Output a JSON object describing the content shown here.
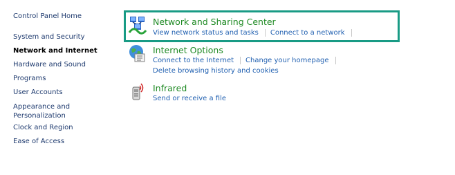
{
  "sidebar": {
    "items": [
      {
        "label": "Control Panel Home"
      },
      {
        "label": "System and Security"
      },
      {
        "label": "Network and Internet"
      },
      {
        "label": "Hardware and Sound"
      },
      {
        "label": "Programs"
      },
      {
        "label": "User Accounts"
      },
      {
        "label": "Appearance and Personalization"
      },
      {
        "label": "Clock and Region"
      },
      {
        "label": "Ease of Access"
      }
    ]
  },
  "categories": [
    {
      "title": "Network and Sharing Center",
      "icon": "network-sharing-icon",
      "tasks": [
        "View network status and tasks",
        "Connect to a network"
      ]
    },
    {
      "title": "Internet Options",
      "icon": "internet-options-icon",
      "tasks": [
        "Connect to the Internet",
        "Change your homepage",
        "Delete browsing history and cookies"
      ]
    },
    {
      "title": "Infrared",
      "icon": "infrared-icon",
      "tasks": [
        "Send or receive a file"
      ]
    }
  ],
  "colors": {
    "category_title": "#1f8a24",
    "task_link": "#1f5fb0",
    "sidebar_link": "#1e3a6e",
    "highlight": "#199b85"
  }
}
